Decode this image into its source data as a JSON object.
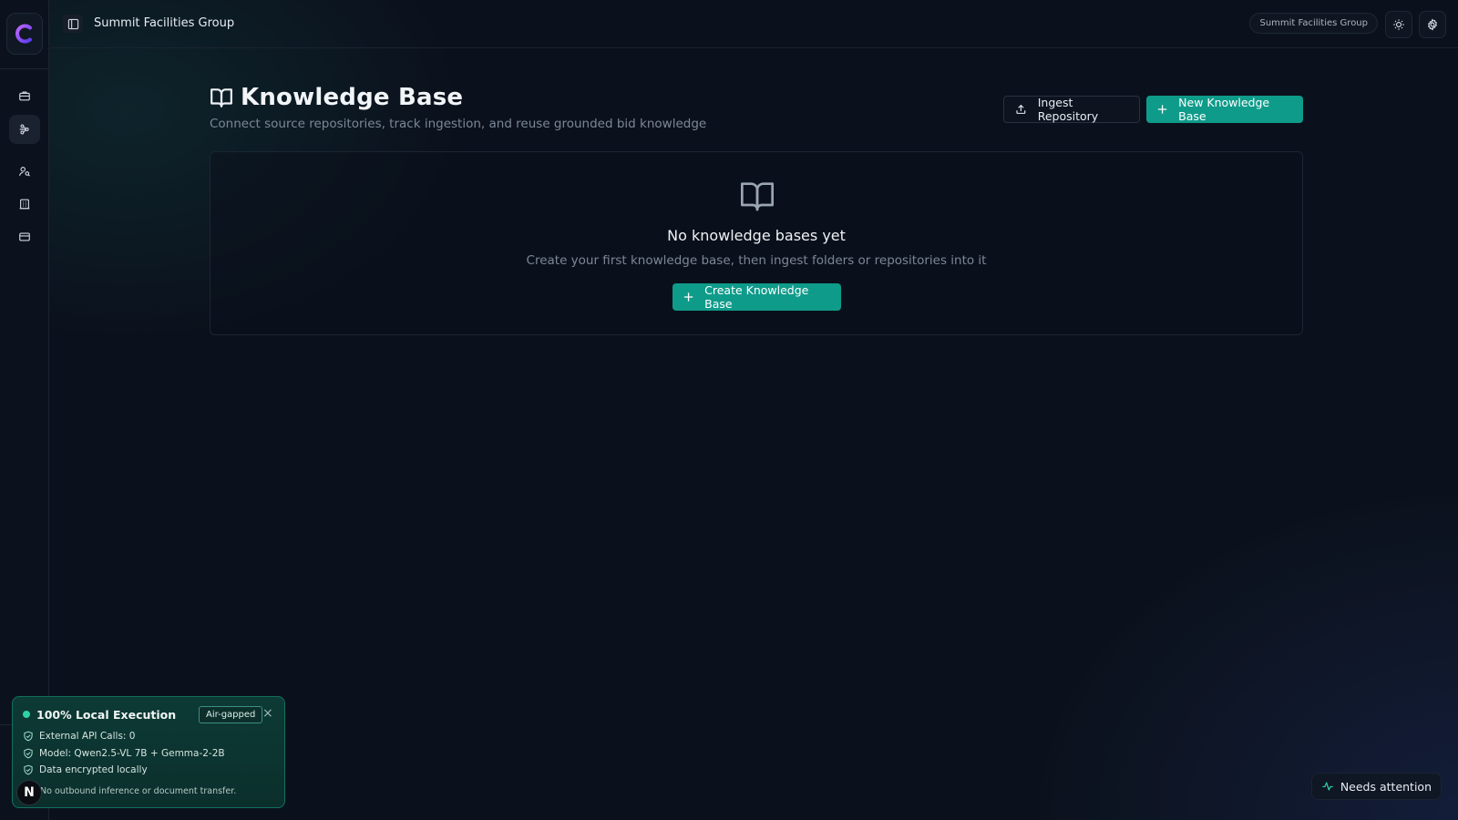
{
  "app": {
    "org_name": "Summit Facilities Group"
  },
  "topbar": {
    "title": "Summit Facilities Group",
    "org_pill": "Summit Facilities Group"
  },
  "sidebar": {
    "items": [
      {
        "icon": "briefcase-icon"
      },
      {
        "icon": "workflow-icon",
        "active": true
      },
      {
        "icon": "user-search-icon"
      },
      {
        "icon": "building-icon"
      },
      {
        "icon": "credit-card-icon"
      }
    ]
  },
  "page": {
    "title": "Knowledge Base",
    "subtitle": "Connect source repositories, track ingestion, and reuse grounded bid knowledge",
    "ingest_button": "Ingest Repository",
    "new_button": "New Knowledge Base"
  },
  "empty_state": {
    "title": "No knowledge bases yet",
    "text": "Create your first knowledge base, then ingest folders or repositories into it",
    "button": "Create Knowledge Base"
  },
  "local_panel": {
    "title": "100% Local Execution",
    "badge": "Air-gapped",
    "rows": [
      "External API Calls: 0",
      "Model: Qwen2.5-VL 7B + Gemma-2-2B",
      "Data encrypted locally"
    ],
    "footer": "No outbound inference or document transfer.",
    "avatar_letter": "N"
  },
  "status": {
    "label": "Needs attention"
  },
  "colors": {
    "accent": "#0f9b8a",
    "background": "#0b111c",
    "panel_green": "#0d3a35"
  }
}
